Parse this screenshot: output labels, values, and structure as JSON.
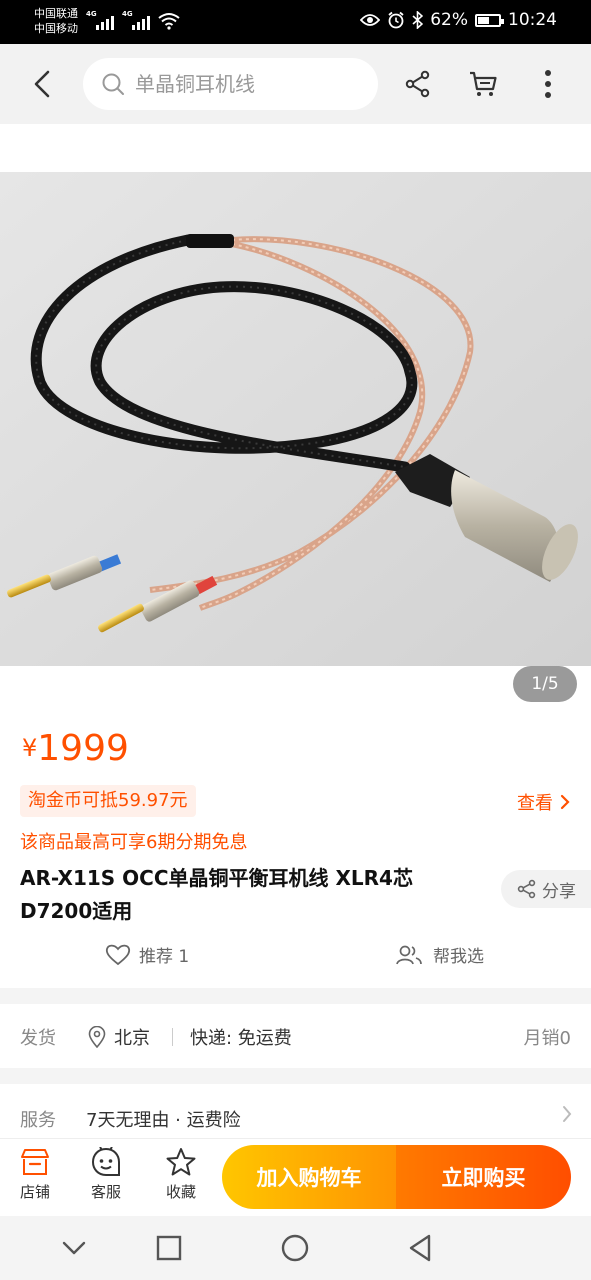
{
  "status_bar": {
    "carrier_1": "中国联通",
    "carrier_2": "中国移动",
    "network_1": "4G",
    "network_2": "4G",
    "battery_level": 62,
    "battery_text": "62%",
    "time": "10:24",
    "icons": [
      "signal-icon",
      "wifi-icon",
      "eye-icon",
      "alarm-icon",
      "bluetooth-icon",
      "battery-icon"
    ]
  },
  "header": {
    "search_placeholder": "单晶铜耳机线",
    "icons": [
      "back-arrow-icon",
      "search-icon",
      "share-icon",
      "cart-icon",
      "more-icon"
    ]
  },
  "gallery": {
    "page_current": "1",
    "page_total": "5",
    "page_label": "1/5"
  },
  "product": {
    "currency": "¥",
    "price": "1999",
    "coin_tag": "淘金币可抵59.97元",
    "view_label": "查看",
    "installment": "该商品最高可享6期分期免息",
    "title": "AR-X11S OCC单晶铜平衡耳机线 XLR4芯D7200适用",
    "share_label": "分享",
    "recommend_label": "推荐 1",
    "help_choose_label": "帮我选"
  },
  "shipping": {
    "label": "发货",
    "location": "北京",
    "express": "快递: 免运费",
    "monthly_sales": "月销0"
  },
  "service": {
    "label": "服务",
    "value": "7天无理由 · 运费险"
  },
  "action_bar": {
    "store_label": "店铺",
    "service_label": "客服",
    "favorite_label": "收藏",
    "add_cart_label": "加入购物车",
    "buy_now_label": "立即购买"
  },
  "colors": {
    "accent": "#ff5000",
    "cart_gradient": [
      "#ffc600",
      "#ff9402"
    ],
    "buy_gradient": [
      "#ff7a00",
      "#ff4e00"
    ]
  }
}
